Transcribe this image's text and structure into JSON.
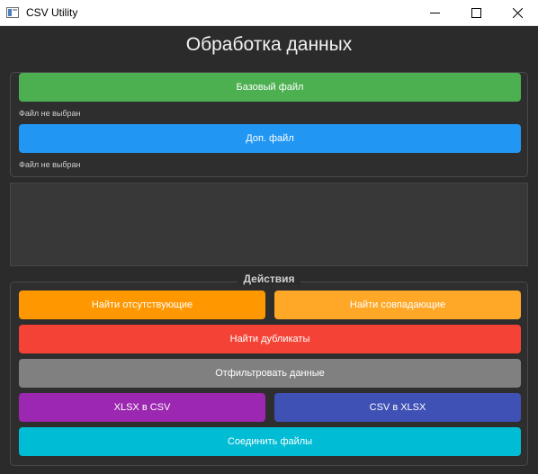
{
  "window": {
    "title": "CSV Utility"
  },
  "heading": "Обработка данных",
  "files": {
    "base_button": "Базовый файл",
    "base_status": "Файл не выбран",
    "extra_button": "Доп. файл",
    "extra_status": "Файл не выбран"
  },
  "actions": {
    "group_title": "Действия",
    "find_missing": "Найти отсутствующие",
    "find_matches": "Найти совпадающие",
    "find_duplicates": "Найти дубликаты",
    "filter_data": "Отфильтровать данные",
    "xlsx_to_csv": "XLSX в CSV",
    "csv_to_xlsx": "CSV в XLSX",
    "merge_files": "Соединить файлы"
  },
  "colors": {
    "base_button": "#4caf50",
    "extra_button": "#2196f3",
    "find_missing": "#ff9800",
    "find_matches": "#ffa726",
    "find_duplicates": "#f44336",
    "filter_data": "#808080",
    "xlsx_to_csv": "#9c27b0",
    "csv_to_xlsx": "#3f51b5",
    "merge_files": "#00bcd4"
  }
}
